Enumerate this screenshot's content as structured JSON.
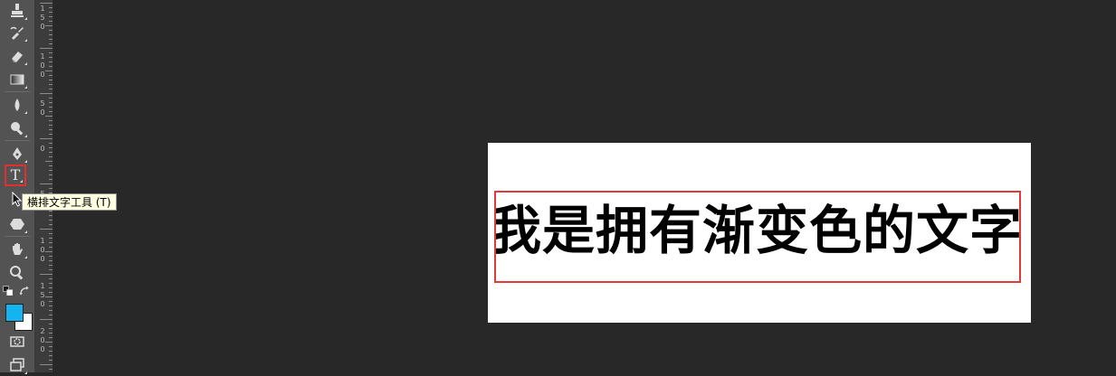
{
  "tooltip": {
    "text": "横排文字工具 (T)"
  },
  "canvas": {
    "text": "我是拥有渐变色的文字"
  },
  "ruler": {
    "labels": [
      [
        "1",
        "5",
        "0"
      ],
      [
        "1",
        "0",
        "0"
      ],
      [
        "5",
        "0"
      ],
      [
        "0"
      ],
      [
        "5",
        "0"
      ],
      [
        "1",
        "0",
        "0"
      ],
      [
        "1",
        "5",
        "0"
      ],
      [
        "2",
        "0",
        "0"
      ]
    ]
  },
  "toolbar": {
    "type_tool_glyph": "T",
    "icons": [
      "clone-stamp-icon",
      "history-brush-icon",
      "eraser-icon",
      "gradient-icon",
      "blur-icon",
      "dodge-icon",
      "pen-icon",
      "type-icon",
      "path-selection-icon",
      "shape-icon",
      "hand-icon",
      "zoom-icon",
      "default-colors-icon",
      "swap-colors-icon",
      "quick-mask-icon",
      "screen-mode-icon"
    ]
  },
  "colors": {
    "foreground": "#14b4f0",
    "background": "#ffffff",
    "highlight": "#e03030"
  }
}
